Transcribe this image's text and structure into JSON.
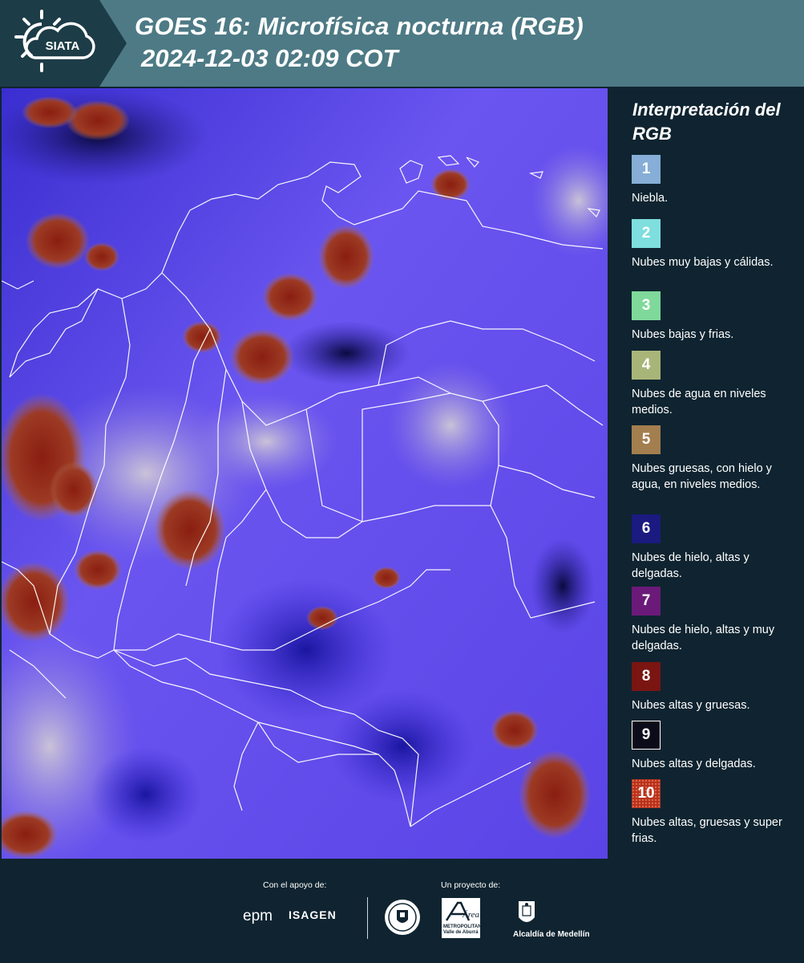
{
  "header": {
    "logo_text": "SIATA",
    "title": "GOES 16: Microfísica nocturna (RGB)",
    "subtitle": "2024-12-03 02:09 COT"
  },
  "legend": {
    "title": "Interpretación del RGB",
    "items": [
      {
        "number": "1",
        "label": "Niebla.",
        "color": "#86aed6"
      },
      {
        "number": "2",
        "label": "Nubes muy bajas y cálidas.",
        "color": "#7fdede"
      },
      {
        "number": "3",
        "label": "Nubes bajas y frias.",
        "color": "#7fd99a"
      },
      {
        "number": "4",
        "label": "Nubes de agua en niveles medios.",
        "color": "#a8b578"
      },
      {
        "number": "5",
        "label": "Nubes gruesas, con hielo y agua, en niveles medios.",
        "color": "#a37e4f"
      },
      {
        "number": "6",
        "label": "Nubes de hielo, altas y delgadas.",
        "color": "#1b1a80"
      },
      {
        "number": "7",
        "label": "Nubes de hielo, altas y muy delgadas.",
        "color": "#6b1a7a"
      },
      {
        "number": "8",
        "label": "Nubes altas y gruesas.",
        "color": "#7a1512"
      },
      {
        "number": "9",
        "label": "Nubes altas y delgadas.",
        "color": "#0b0b1a"
      },
      {
        "number": "10",
        "label": "Nubes altas, gruesas y super frias.",
        "color": "#b8331e"
      }
    ]
  },
  "footer": {
    "support_label": "Con el apoyo de:",
    "project_label": "Un proyecto de:",
    "sponsor_epm": "epm",
    "sponsor_isagen": "ISAGEN",
    "partner_area_title": "Área",
    "partner_area_sub": "METROPOLITANA Valle de Aburrá",
    "partner_alcaldia": "Alcaldía de Medellín"
  },
  "colors": {
    "header_bg": "#4d7a85",
    "page_bg": "#0f2430",
    "map_base": "#5b3fe8"
  }
}
